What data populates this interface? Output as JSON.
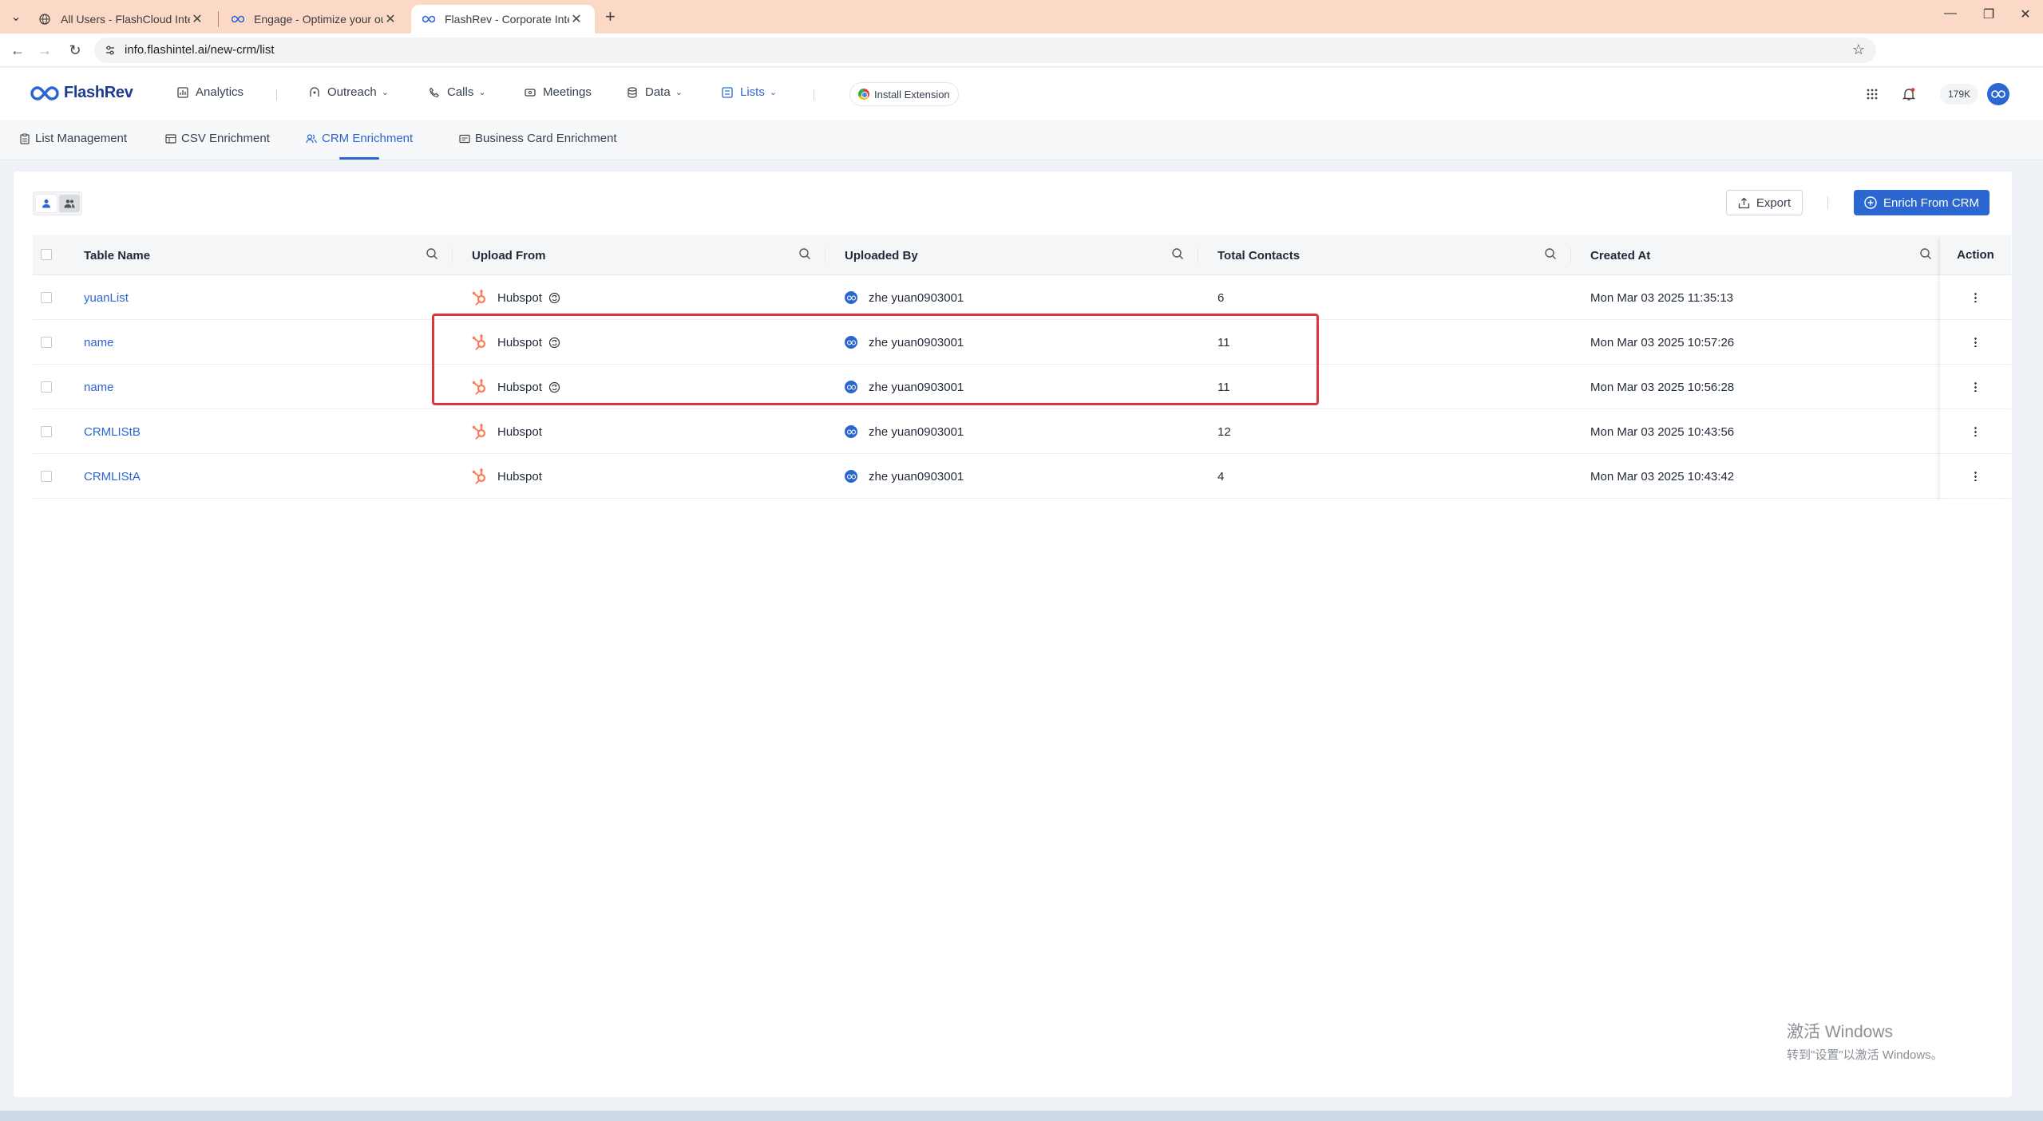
{
  "browser": {
    "tabs": [
      {
        "label": "All Users - FlashCloud Intellig",
        "active": false
      },
      {
        "label": "Engage - Optimize your outr",
        "active": false
      },
      {
        "label": "FlashRev - Corporate Intellig",
        "active": true
      }
    ],
    "url": "info.flashintel.ai/new-crm/list"
  },
  "app": {
    "logo": "FlashRev",
    "nav": [
      {
        "label": "Analytics",
        "icon": "chart-icon"
      },
      {
        "label": "Outreach",
        "icon": "outreach-icon",
        "dropdown": true
      },
      {
        "label": "Calls",
        "icon": "phone-icon",
        "dropdown": true
      },
      {
        "label": "Meetings",
        "icon": "video-icon"
      },
      {
        "label": "Data",
        "icon": "database-icon",
        "dropdown": true
      },
      {
        "label": "Lists",
        "icon": "list-icon",
        "dropdown": true,
        "active": true
      }
    ],
    "install_extension": "Install Extension",
    "credits": "179K"
  },
  "subnav": {
    "tabs": [
      {
        "label": "List Management",
        "icon": "clipboard-icon"
      },
      {
        "label": "CSV Enrichment",
        "icon": "table-icon"
      },
      {
        "label": "CRM Enrichment",
        "icon": "users-icon",
        "active": true
      },
      {
        "label": "Business Card Enrichment",
        "icon": "card-icon"
      }
    ]
  },
  "toolbar": {
    "export_label": "Export",
    "enrich_label": "Enrich From CRM"
  },
  "table": {
    "columns": [
      "Table Name",
      "Upload From",
      "Uploaded By",
      "Total Contacts",
      "Created At",
      "Action"
    ],
    "rows": [
      {
        "name": "yuanList",
        "source": "Hubspot",
        "synced": true,
        "uploader": "zhe yuan0903001",
        "contacts": "6",
        "created": "Mon Mar 03 2025 11:35:13"
      },
      {
        "name": "name",
        "source": "Hubspot",
        "synced": true,
        "uploader": "zhe yuan0903001",
        "contacts": "11",
        "created": "Mon Mar 03 2025 10:57:26"
      },
      {
        "name": "name",
        "source": "Hubspot",
        "synced": true,
        "uploader": "zhe yuan0903001",
        "contacts": "11",
        "created": "Mon Mar 03 2025 10:56:28"
      },
      {
        "name": "CRMLIStB",
        "source": "Hubspot",
        "synced": false,
        "uploader": "zhe yuan0903001",
        "contacts": "12",
        "created": "Mon Mar 03 2025 10:43:56"
      },
      {
        "name": "CRMLIStA",
        "source": "Hubspot",
        "synced": false,
        "uploader": "zhe yuan0903001",
        "contacts": "4",
        "created": "Mon Mar 03 2025 10:43:42"
      }
    ]
  },
  "watermark": {
    "line1": "激活 Windows",
    "line2": "转到\"设置\"以激活 Windows。"
  },
  "colors": {
    "accent": "#2c66d0",
    "hubspot": "#ff7a59",
    "highlight": "#d9363e",
    "tabbar": "#fcd9c7"
  }
}
